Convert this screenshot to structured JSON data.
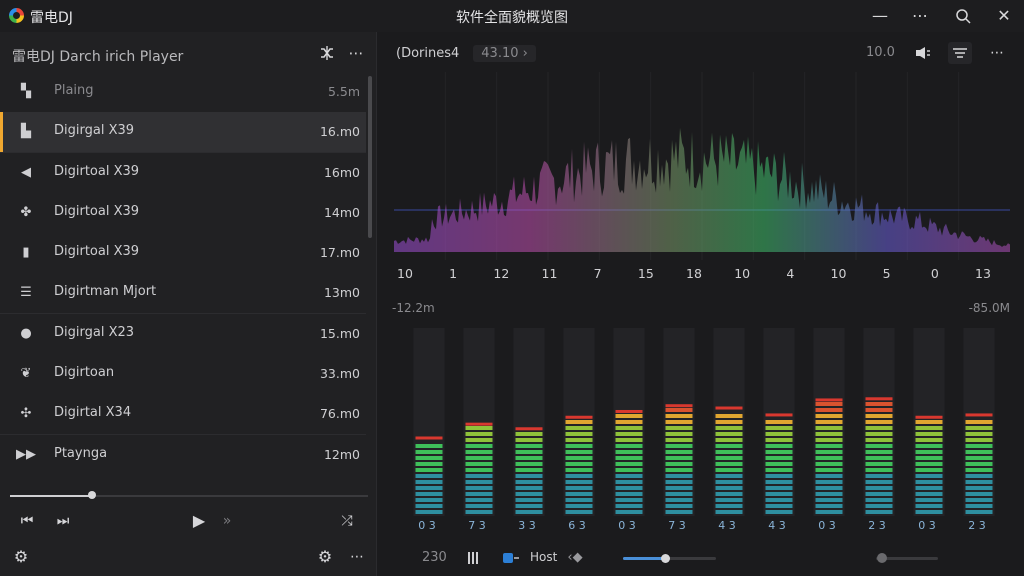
{
  "app": {
    "name": "雷电DJ",
    "window_title": "软件全面貌概览图"
  },
  "window_controls": {
    "minimize": "—",
    "restore": "⋯",
    "search": "⌕",
    "close": "✕"
  },
  "left": {
    "header_title": "雷电DJ Darch irich Player",
    "header_icons": [
      "shuffle-icon",
      "more-icon"
    ],
    "tracks": [
      {
        "icon": "grid-icon",
        "glyph": "▚",
        "title": "Plaing",
        "time": "5.5m"
      },
      {
        "icon": "book-icon",
        "glyph": "▙",
        "title": "Digirgal X39",
        "time": "16.m0"
      },
      {
        "icon": "speaker-icon",
        "glyph": "◀",
        "title": "Digirtoal X39",
        "time": "16m0"
      },
      {
        "icon": "leaf-icon",
        "glyph": "✤",
        "title": "Digirtoal X39",
        "time": "14m0"
      },
      {
        "icon": "bars-icon",
        "glyph": "▮",
        "title": "Digirtoal X39",
        "time": "17.m0"
      },
      {
        "icon": "lines-icon",
        "glyph": "☰",
        "title": "Digirtman Mjort",
        "time": "13m0"
      },
      {
        "icon": "bubble-icon",
        "glyph": "●",
        "title": "Digirgal X23",
        "time": "15.m0"
      },
      {
        "icon": "wings-icon",
        "glyph": "❦",
        "title": "Digirtoan",
        "time": "33.m0"
      },
      {
        "icon": "cluster-icon",
        "glyph": "✣",
        "title": "Digirtal X34",
        "time": "76.m0"
      },
      {
        "icon": "forward-icon",
        "glyph": "▶▶",
        "title": "Ptaynga",
        "time": "12m0"
      }
    ],
    "seek_progress": 0.23,
    "controls": {
      "prev": "⏮",
      "next": "⏭",
      "play": "▶",
      "skip": "»",
      "shuffle": "⤮"
    },
    "footer": {
      "settings": "⚙",
      "more": "⋯"
    }
  },
  "right": {
    "source_label": "(Dorines4",
    "source_value": "43.10 ›",
    "top_value": "10.0",
    "spectrum_labels": [
      "10",
      "1",
      "12",
      "11",
      "7",
      "15",
      "18",
      "10",
      "4",
      "10",
      "5",
      "0",
      "13"
    ],
    "range_left": "-12.2m",
    "range_right": "-85.0M",
    "meter_labels": [
      "0 3",
      "7 3",
      "3 3",
      "6 3",
      "0 3",
      "7 3",
      "4 3",
      "4 3",
      "0 3",
      "2 3",
      "0 3",
      "2 3"
    ],
    "meter_levels": [
      0.64,
      0.76,
      0.73,
      0.84,
      0.87,
      0.92,
      0.91,
      0.84,
      0.97,
      0.97,
      0.84,
      0.84
    ],
    "meter_peaks": [
      0.62,
      0.74,
      0.7,
      0.8,
      0.85,
      0.9,
      0.88,
      0.82,
      0.95,
      0.96,
      0.8,
      0.82
    ],
    "bottom_value": "230",
    "host_label": "Host",
    "volume": 0.45,
    "balance": 0.1
  }
}
